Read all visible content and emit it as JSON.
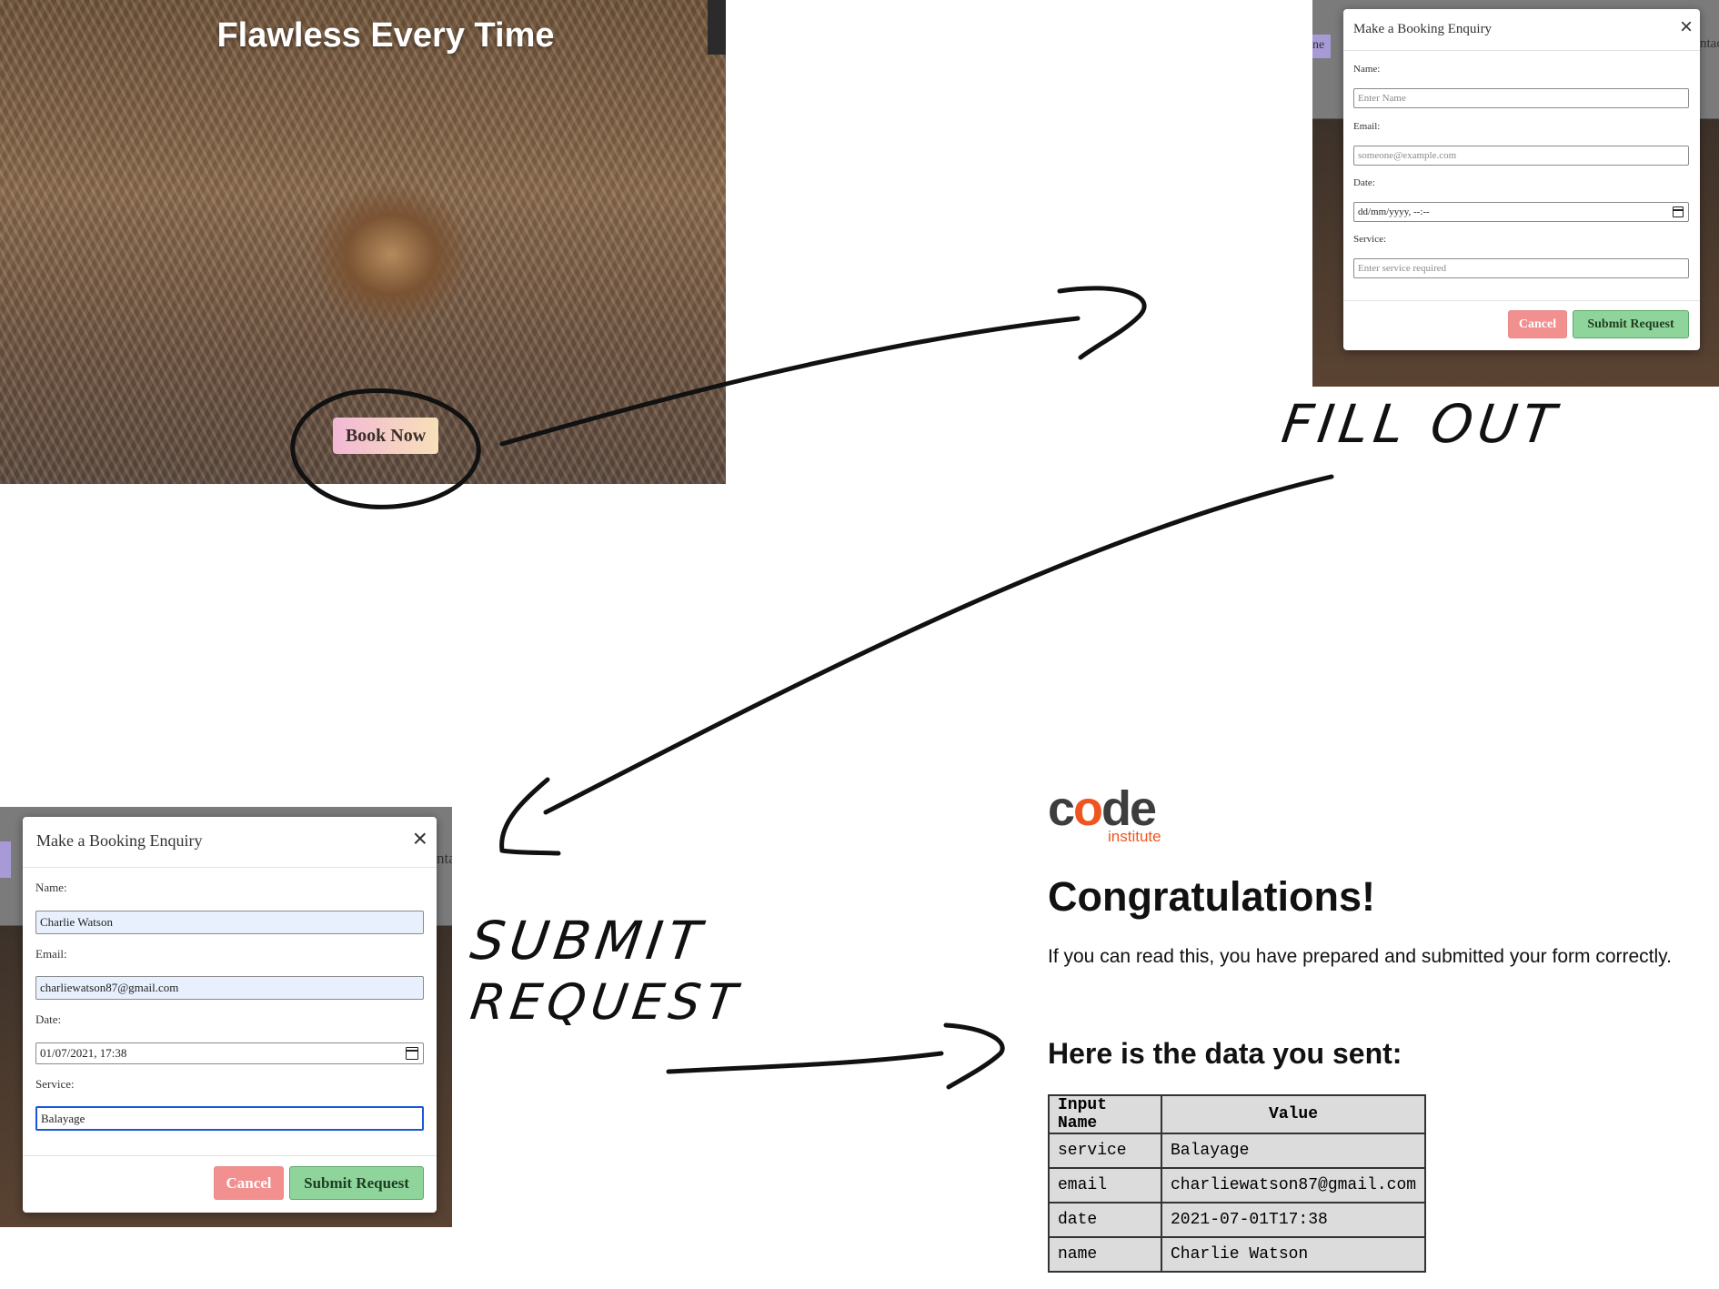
{
  "hero": {
    "title": "Flawless Every Time",
    "book_now_label": "Book Now"
  },
  "modal_empty": {
    "title": "Make a Booking Enquiry",
    "close_symbol": "×",
    "tab_partial_left": "ne",
    "tab_partial_right": "ntac",
    "fields": {
      "name_label": "Name:",
      "name_placeholder": "Enter Name",
      "email_label": "Email:",
      "email_placeholder": "someone@example.com",
      "date_label": "Date:",
      "date_value": "dd/mm/yyyy, --:--",
      "service_label": "Service:",
      "service_placeholder": "Enter service required"
    },
    "cancel_label": "Cancel",
    "submit_label": "Submit Request"
  },
  "modal_filled": {
    "title": "Make a Booking Enquiry",
    "close_symbol": "×",
    "tab_partial_right": "nta",
    "fields": {
      "name_label": "Name:",
      "name_value": "Charlie Watson",
      "email_label": "Email:",
      "email_value": "charliewatson87@gmail.com",
      "date_label": "Date:",
      "date_value": "01/07/2021, 17:38",
      "service_label": "Service:",
      "service_value": "Balayage"
    },
    "cancel_label": "Cancel",
    "submit_label": "Submit Request"
  },
  "result": {
    "logo_word_prefix": "c",
    "logo_word_o": "o",
    "logo_word_suffix": "de",
    "logo_sub": "institute",
    "heading": "Congratulations!",
    "message": "If you can read this, you have prepared and submitted your form correctly.",
    "subheading": "Here is the data you sent:",
    "table_headers": [
      "Input Name",
      "Value"
    ],
    "rows": [
      [
        "service",
        "Balayage"
      ],
      [
        "email",
        "charliewatson87@gmail.com"
      ],
      [
        "date",
        "2021-07-01T17:38"
      ],
      [
        "name",
        "Charlie Watson"
      ]
    ]
  },
  "annotations": {
    "fill_out": "FILL OUT",
    "submit": "SUBMIT",
    "request": "REQUEST"
  }
}
